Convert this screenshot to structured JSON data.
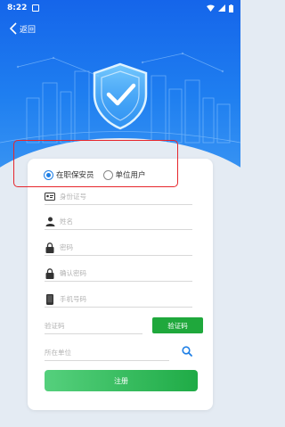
{
  "status_bar": {
    "time": "8:22"
  },
  "nav": {
    "back_label": "返回"
  },
  "role_options": [
    {
      "label": "在职保安员",
      "selected": true
    },
    {
      "label": "单位用户",
      "selected": false
    }
  ],
  "form": {
    "id_card_placeholder": "身份证号",
    "name_placeholder": "姓名",
    "password_placeholder": "密码",
    "confirm_password_placeholder": "确认密码",
    "phone_placeholder": "手机号码",
    "code_placeholder": "验证码",
    "get_code_label": "验证码",
    "unit_placeholder": "所在单位",
    "submit_label": "注册"
  },
  "colors": {
    "hero_blue": "#1f7ff0",
    "accent_green": "#1fa83c",
    "radio_blue": "#1e7fe6",
    "highlight_red": "#e6262c"
  }
}
